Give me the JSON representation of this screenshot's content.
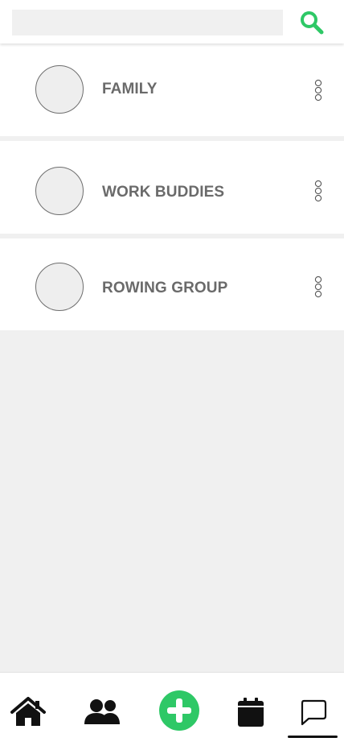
{
  "search": {
    "value": "",
    "placeholder": "",
    "icon": "search-icon",
    "icon_color": "#2ec866"
  },
  "groups": [
    {
      "name": "FAMILY",
      "menu_icon": "more-vertical-icon"
    },
    {
      "name": "WORK BUDDIES",
      "menu_icon": "more-vertical-icon"
    },
    {
      "name": "ROWING GROUP",
      "menu_icon": "more-vertical-icon"
    }
  ],
  "bottom_nav": {
    "items": [
      {
        "icon": "home-icon",
        "active": false
      },
      {
        "icon": "people-icon",
        "active": false
      },
      {
        "icon": "add-circle-icon",
        "active": false,
        "color": "#2ec866"
      },
      {
        "icon": "calendar-icon",
        "active": false
      },
      {
        "icon": "chat-icon",
        "active": true
      }
    ]
  },
  "colors": {
    "accent": "#2ec866",
    "background": "#f0f0f0",
    "text": "#6a6a6a"
  }
}
